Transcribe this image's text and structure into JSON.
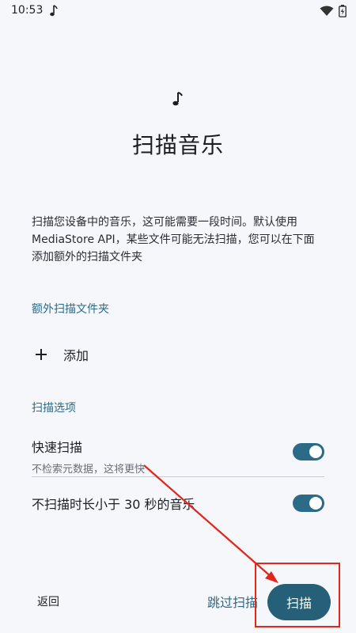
{
  "status_bar": {
    "time": "10:53",
    "note_icon": "music-note-icon",
    "wifi_icon": "wifi-icon",
    "battery_icon": "battery-icon"
  },
  "header": {
    "icon": "music-note-icon",
    "title": "扫描音乐"
  },
  "description": "扫描您设备中的音乐，这可能需要一段时间。默认使用 MediaStore API，某些文件可能无法扫描，您可以在下面添加额外的扫描文件夹",
  "extra_folders": {
    "section_label": "额外扫描文件夹",
    "add_label": "添加"
  },
  "scan_options": {
    "section_label": "扫描选项",
    "quick_scan": {
      "title": "快速扫描",
      "subtitle": "不检索元数据，这将更快",
      "enabled": true
    },
    "skip_short": {
      "title": "不扫描时长小于 30 秒的音乐",
      "enabled": true
    }
  },
  "footer": {
    "back_label": "返回",
    "skip_label": "跳过扫描",
    "scan_label": "扫描"
  },
  "colors": {
    "accent": "#2c6b88",
    "button": "#255f78",
    "annotation": "#e1261c",
    "background": "#f5f7fb"
  }
}
